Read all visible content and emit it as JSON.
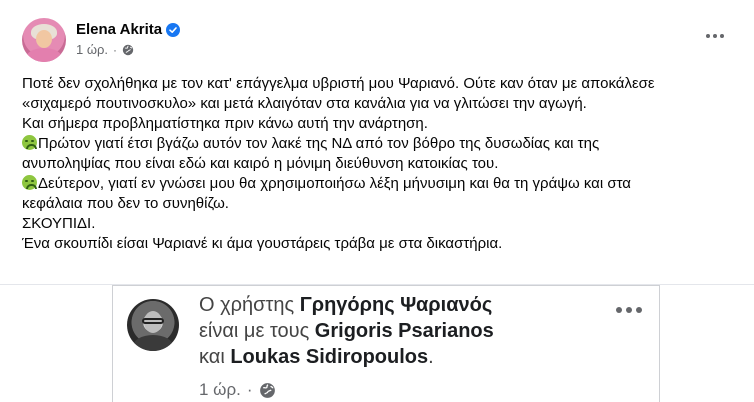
{
  "post": {
    "author": "Elena Akrita",
    "time": "1 ώρ.",
    "separator": "·",
    "icons": {
      "verified": "verified-badge-icon",
      "audience": "globe-icon",
      "more": "more-horizontal-icon"
    },
    "colors": {
      "verified": "#1877f2",
      "meta": "#65676b",
      "text": "#050505"
    },
    "lines": [
      "Ποτέ δεν σχολήθηκα με τον κατ' επάγγελμα υβριστή μου Ψαριανό. Ούτε καν όταν με αποκάλεσε",
      "«σιχαμερό πουτινοσκυλο» και μετά κλαιγόταν στα κανάλια για να γλιτώσει την αγωγή.",
      "Και σήμερα προβληματίστηκα πριν κάνω αυτή την ανάρτηση.",
      "Πρώτον γιατί έτσι βγάζω αυτόν τον λακέ της ΝΔ από τον βόθρο της δυσωδίας και της",
      "ανυποληψίας που είναι εδώ και καιρό η μόνιμη διεύθυνση κατοικίας του.",
      "Δεύτερον, γιατί εν γνώσει μου θα χρησιμοποιήσω λέξη μήνυσιμη και θα τη γράψω και στα",
      "κεφάλαια που δεν το συνηθίζω.",
      "ΣΚΟΥΠΙΔΙ.",
      "Ένα σκουπίδι είσαι Ψαριανέ κι άμα γουστάρεις τράβα με στα δικαστήρια."
    ],
    "emoji_name": "nauseated-face-icon"
  },
  "embed": {
    "line1_prefix": "Ο χρήστης ",
    "line1_name": "Γρηγόρης Ψαριανός",
    "line2_prefix": "είναι με τους ",
    "line2_name": "Grigoris Psarianos",
    "line3_prefix": "και ",
    "line3_name": "Loukas Sidiropoulos",
    "line3_suffix": ".",
    "time": "1 ώρ.",
    "separator": "·"
  }
}
